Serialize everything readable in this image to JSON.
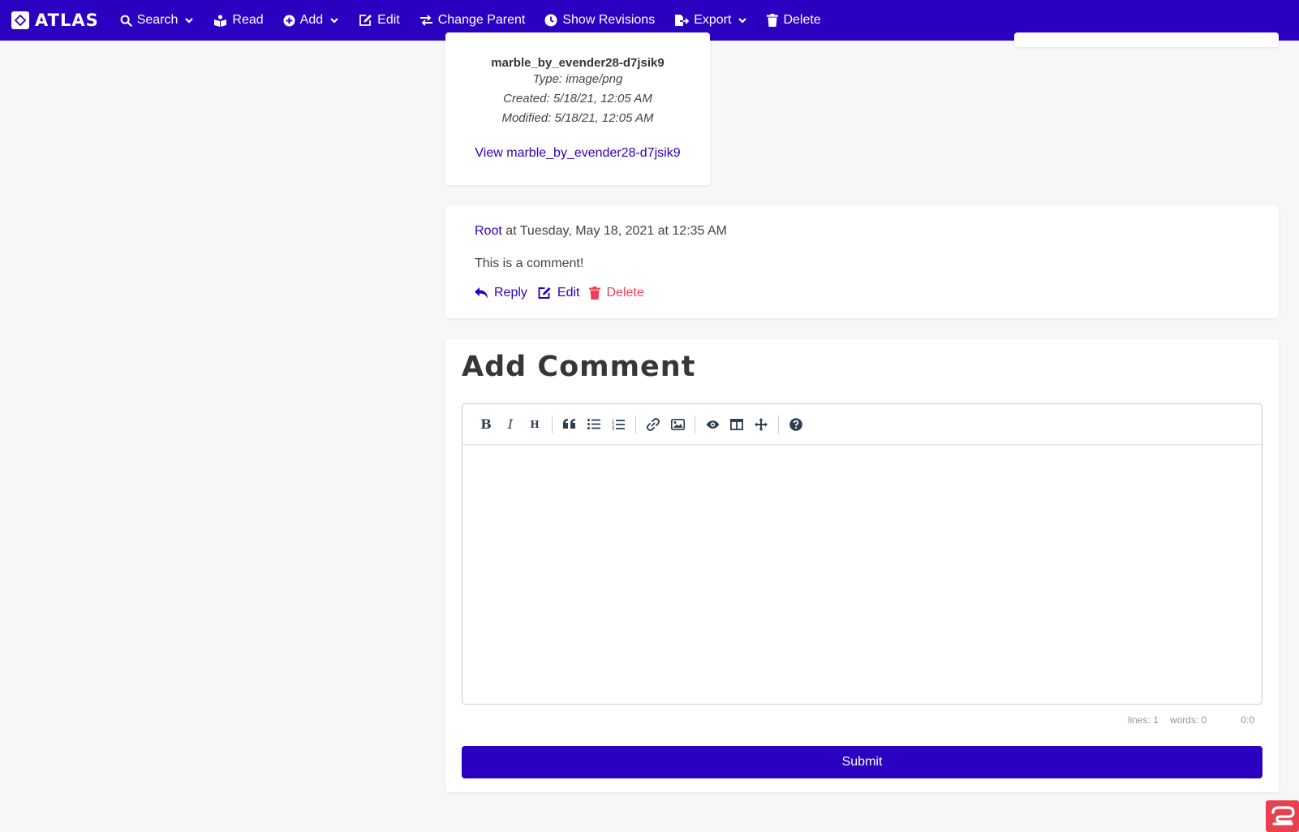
{
  "navbar": {
    "brand": "ATLAS",
    "items": [
      {
        "label": "Search",
        "icon": "search-icon",
        "dropdown": true
      },
      {
        "label": "Read",
        "icon": "book-reader-icon",
        "dropdown": false
      },
      {
        "label": "Add",
        "icon": "plus-circle-icon",
        "dropdown": true
      },
      {
        "label": "Edit",
        "icon": "edit-icon",
        "dropdown": false
      },
      {
        "label": "Change Parent",
        "icon": "exchange-icon",
        "dropdown": false
      },
      {
        "label": "Show Revisions",
        "icon": "clock-icon",
        "dropdown": false
      },
      {
        "label": "Export",
        "icon": "file-export-icon",
        "dropdown": true
      },
      {
        "label": "Delete",
        "icon": "trash-icon",
        "dropdown": false
      }
    ]
  },
  "file": {
    "name": "marble_by_evender28-d7jsik9",
    "type": "Type: image/png",
    "created": "Created: 5/18/21, 12:05 AM",
    "modified": "Modified: 5/18/21, 12:05 AM",
    "link": "View marble_by_evender28-d7jsik9"
  },
  "comment": {
    "author": "Root",
    "timestamp": " at Tuesday, May 18, 2021 at 12:35 AM",
    "body": "This is a comment!",
    "actions": {
      "reply": "Reply",
      "edit": "Edit",
      "delete": "Delete"
    }
  },
  "add_comment": {
    "title": "Add Comment",
    "toolbar": [
      "bold",
      "italic",
      "heading",
      "quote",
      "unordered-list",
      "ordered-list",
      "link",
      "image",
      "preview",
      "side-by-side",
      "fullscreen",
      "guide"
    ],
    "status": {
      "lines": "lines: 1",
      "words": "words: 0",
      "cursor": "0:0"
    },
    "submit": "Submit"
  },
  "colors": {
    "primary": "#2b00c0",
    "danger": "#f03e5a",
    "badge": "#e8404f"
  }
}
